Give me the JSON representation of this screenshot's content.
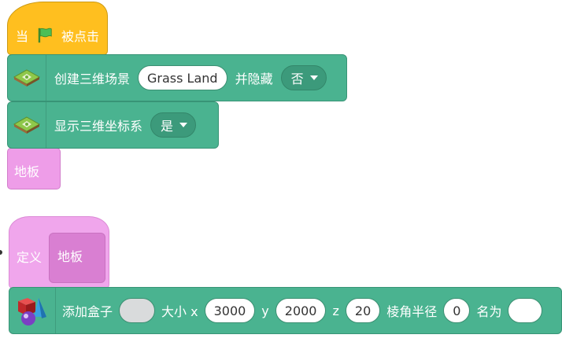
{
  "hat": {
    "prefix": "当",
    "suffix": "被点击",
    "flag_icon": "green-flag-icon"
  },
  "block1": {
    "label": "创建三维场景",
    "scene_name": "Grass Land",
    "hide_label": "并隐藏",
    "hide_value": "否"
  },
  "block2": {
    "label": "显示三维坐标系",
    "value": "是"
  },
  "call_block": {
    "label": "地板"
  },
  "define_block": {
    "label": "定义",
    "proto_name": "地板"
  },
  "add_box": {
    "label": "添加盒子",
    "size_label": "大小 x",
    "x": "3000",
    "y_label": "y",
    "y": "2000",
    "z_label": "z",
    "z": "20",
    "radius_label": "棱角半径",
    "radius": "0",
    "name_label": "名为",
    "name": ""
  },
  "colors": {
    "events": "#ffbf1f",
    "green": "#4ab390",
    "pink": "#ee9de8"
  }
}
